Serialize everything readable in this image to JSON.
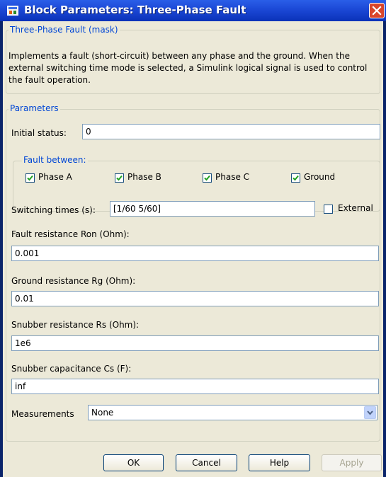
{
  "window": {
    "title": "Block Parameters: Three-Phase Fault"
  },
  "mask": {
    "legend": "Three-Phase Fault (mask)",
    "description": "Implements a fault (short-circuit) between any phase and the ground. When the external switching time mode is selected, a Simulink logical signal is used to control the fault operation."
  },
  "parameters": {
    "legend": "Parameters",
    "initial_status_label": "Initial status:",
    "initial_status_value": "0",
    "fault_between_legend": "Fault between:",
    "checkboxes": [
      {
        "label": "Phase A",
        "checked": true
      },
      {
        "label": "Phase B",
        "checked": true
      },
      {
        "label": "Phase C",
        "checked": true
      },
      {
        "label": "Ground",
        "checked": true
      }
    ],
    "switching_times_label": "Switching times (s):",
    "switching_times_value": "[1/60  5/60]",
    "external_label": "External",
    "external_checked": false,
    "fault_resistance_label": "Fault resistance Ron (Ohm):",
    "fault_resistance_value": "0.001",
    "ground_resistance_label": "Ground resistance Rg (Ohm):",
    "ground_resistance_value": "0.01",
    "snubber_resistance_label": "Snubber resistance Rs (Ohm):",
    "snubber_resistance_value": "1e6",
    "snubber_capacitance_label": "Snubber capacitance Cs (F):",
    "snubber_capacitance_value": "inf",
    "measurements_label": "Measurements",
    "measurements_value": "None"
  },
  "buttons": {
    "ok": "OK",
    "cancel": "Cancel",
    "help": "Help",
    "apply": "Apply"
  },
  "colors": {
    "title_bar": "#1b48d6",
    "legend_text": "#0046d5",
    "dialog_bg": "#ece9d8",
    "close_button": "#d9452b"
  }
}
